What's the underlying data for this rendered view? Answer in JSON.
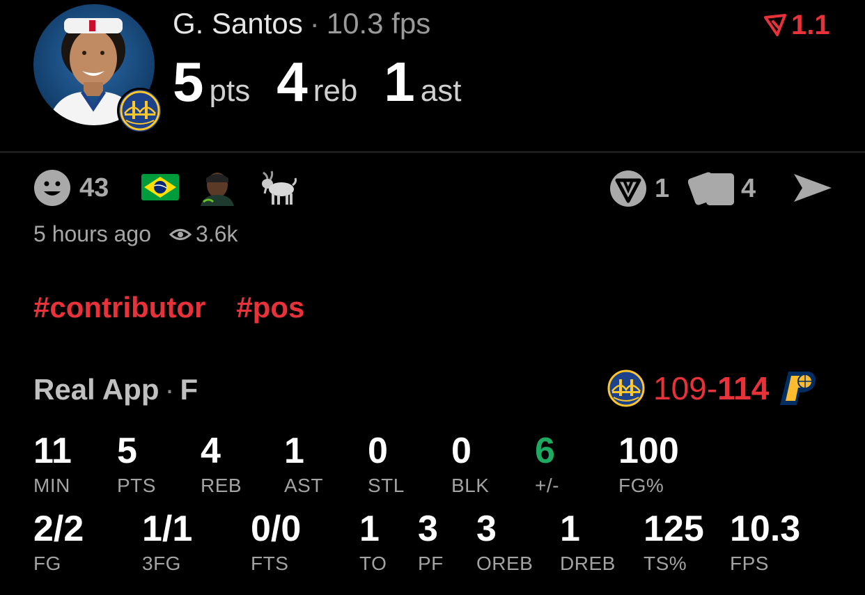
{
  "player": {
    "name": "G. Santos",
    "fps": "10.3 fps",
    "headline": [
      {
        "value": "5",
        "unit": "pts"
      },
      {
        "value": "4",
        "unit": "reb"
      },
      {
        "value": "1",
        "unit": "ast"
      }
    ],
    "rating": "1.1"
  },
  "reactions": {
    "emoji_count": "43",
    "shield_count": "1",
    "cards_count": "4"
  },
  "meta": {
    "time_ago": "5 hours ago",
    "views": "3.6k"
  },
  "tags": [
    "#contributor",
    "#pos"
  ],
  "source": {
    "app": "Real App",
    "position": "F"
  },
  "game": {
    "score_left": "109",
    "score_dash": "-",
    "score_right": "114"
  },
  "stats_row1": [
    {
      "value": "11",
      "label": "MIN"
    },
    {
      "value": "5",
      "label": "PTS"
    },
    {
      "value": "4",
      "label": "REB"
    },
    {
      "value": "1",
      "label": "AST"
    },
    {
      "value": "0",
      "label": "STL"
    },
    {
      "value": "0",
      "label": "BLK"
    },
    {
      "value": "6",
      "label": "+/-"
    },
    {
      "value": "100",
      "label": "FG%"
    }
  ],
  "stats_row2": [
    {
      "value": "2/2",
      "label": "FG"
    },
    {
      "value": "1/1",
      "label": "3FG"
    },
    {
      "value": "0/0",
      "label": "FTS"
    },
    {
      "value": "1",
      "label": "TO"
    },
    {
      "value": "3",
      "label": "PF"
    },
    {
      "value": "3",
      "label": "OREB"
    },
    {
      "value": "1",
      "label": "DREB"
    },
    {
      "value": "125",
      "label": "TS%"
    },
    {
      "value": "10.3",
      "label": "FPS"
    }
  ],
  "colors": {
    "accent_red": "#e8323a",
    "positive_green": "#1faa63",
    "warriors_blue": "#1d428a",
    "warriors_gold": "#ffc72c",
    "pacers_navy": "#002d62",
    "pacers_gold": "#fdbb30",
    "brazil_green": "#009c3b",
    "brazil_yellow": "#ffdf00"
  },
  "icons": [
    "player-avatar",
    "warriors-logo-icon",
    "rating-arrow-icon",
    "smiley-icon",
    "brazil-flag-icon",
    "player-thumb-icon",
    "goat-icon",
    "shield-v-icon",
    "cards-icon",
    "send-icon",
    "eye-icon",
    "pacers-logo-icon"
  ]
}
